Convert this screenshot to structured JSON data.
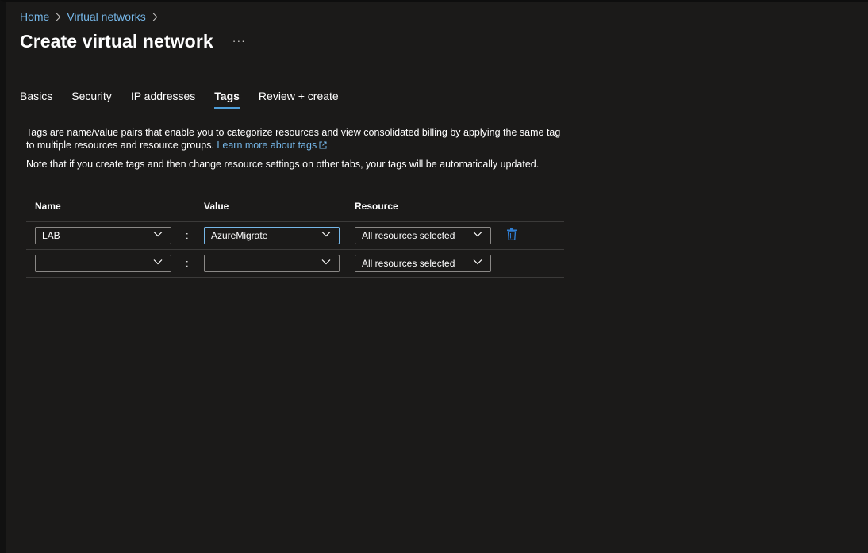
{
  "breadcrumb": {
    "home": "Home",
    "virtual_networks": "Virtual networks"
  },
  "title": "Create virtual network",
  "more_label": "···",
  "tabs": [
    {
      "label": "Basics"
    },
    {
      "label": "Security"
    },
    {
      "label": "IP addresses"
    },
    {
      "label": "Tags",
      "active": true
    },
    {
      "label": "Review + create"
    }
  ],
  "description": {
    "text": "Tags are name/value pairs that enable you to categorize resources and view consolidated billing by applying the same tag to multiple resources and resource groups.",
    "link": "Learn more about tags"
  },
  "note": "Note that if you create tags and then change resource settings on other tabs, your tags will be automatically updated.",
  "grid": {
    "headers": {
      "name": "Name",
      "value": "Value",
      "resource": "Resource"
    },
    "rows": [
      {
        "name": "LAB",
        "value": "AzureMigrate",
        "resource": "All resources selected",
        "separator": ":"
      },
      {
        "name": "",
        "value": "",
        "resource": "All resources selected",
        "separator": ":"
      }
    ]
  },
  "colors": {
    "accent": "#4f9ed8",
    "link": "#75b6e7",
    "background": "#1b1a19",
    "delete_icon": "#2f7dd1"
  },
  "icons": {
    "delete": "trash-icon",
    "dropdown": "chevron-down-icon",
    "external": "external-link-icon"
  }
}
